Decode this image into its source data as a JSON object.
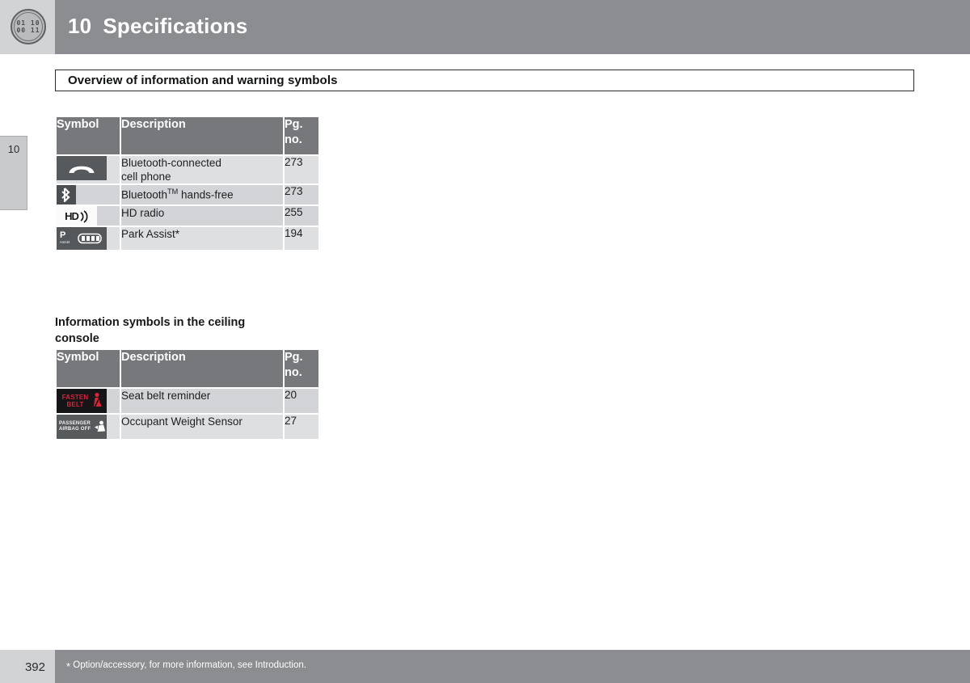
{
  "header": {
    "chapter_number": "10",
    "title": "Specifications",
    "badge_lines": [
      "01 10",
      "00 11"
    ]
  },
  "side_tab": {
    "label": "10"
  },
  "section": {
    "title": "Overview of information and warning symbols"
  },
  "table_one": {
    "columns": [
      "Symbol",
      "Description",
      "Pg.",
      "no."
    ],
    "header_symbol": "Symbol",
    "header_description": "Description",
    "header_pg_line1": "Pg.",
    "header_pg_line2": "no.",
    "rows": [
      {
        "symbol": "bluetooth-phone-icon",
        "description_line1": "Bluetooth-connected",
        "description_line2": "cell phone",
        "page": "273"
      },
      {
        "symbol": "bluetooth-icon",
        "description_prefix": "Bluetooth",
        "description_sup": "TM",
        "description_suffix": " hands-free",
        "page": "273"
      },
      {
        "symbol": "hd-radio-icon",
        "symbol_text": "HD",
        "description": "HD radio",
        "page": "255"
      },
      {
        "symbol": "park-assist-icon",
        "symbol_text": "P",
        "symbol_subtext": "Assist",
        "description": "Park Assist*",
        "page": "194"
      }
    ]
  },
  "subsection": {
    "title_line1": "Information symbols in the ceiling",
    "title_line2": "console"
  },
  "table_two": {
    "header_symbol": "Symbol",
    "header_description": "Description",
    "header_pg_line1": "Pg.",
    "header_pg_line2": "no.",
    "rows": [
      {
        "symbol": "fasten-seat-belt-icon",
        "symbol_text_line1": "FASTEN",
        "symbol_text_line2": "BELT",
        "description": "Seat belt reminder",
        "page": "20"
      },
      {
        "symbol": "passenger-airbag-off-icon",
        "symbol_text_line1": "PASSENGER",
        "symbol_text_line2": "AIRBAG OFF",
        "description": "Occupant Weight Sensor",
        "page": "27"
      }
    ]
  },
  "footer": {
    "page_number": "392",
    "footnote_star": "*",
    "footnote_text": "Option/accessory, for more information, see Introduction."
  },
  "colors": {
    "header_band": "#8b8d90",
    "header_left": "#d2d3d5",
    "table_header": "#76787b",
    "row_light": "#dedfe1",
    "row_dark": "#d3d4d7",
    "belt_red": "#d8253a",
    "text_dark": "#1d1e20"
  }
}
